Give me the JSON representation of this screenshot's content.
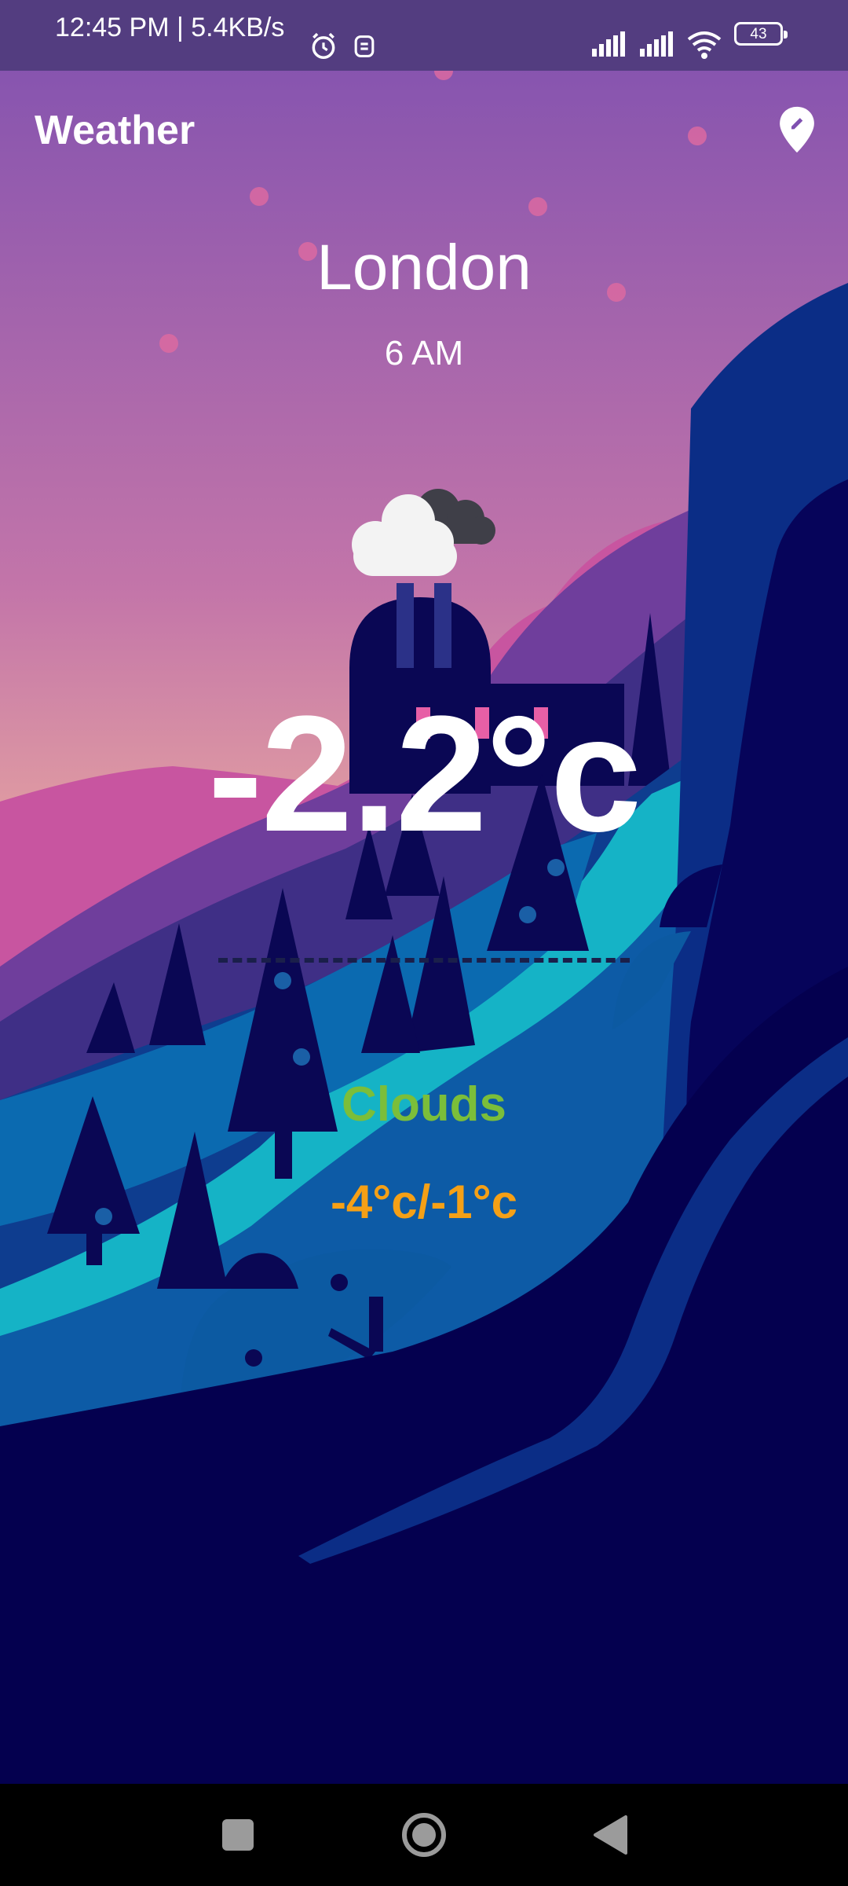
{
  "status_bar": {
    "time_speed": "12:45 PM | 5.4KB/s",
    "battery": "43",
    "icons": [
      "alarm-icon",
      "app-notification-icon",
      "signal-icon",
      "signal-icon",
      "wifi-icon",
      "battery-icon"
    ]
  },
  "app_bar": {
    "title": "Weather",
    "location_icon": "map-pin-edit-icon"
  },
  "weather": {
    "city": "London",
    "time": "6 AM",
    "icon": "cloud-icon",
    "temperature": "-2.2°c",
    "condition": "Clouds",
    "range": "-4°c/-1°c"
  },
  "nav_bar": {
    "buttons": [
      "recents-button",
      "home-button",
      "back-button"
    ]
  },
  "colors": {
    "sky_top": "#7f50b0",
    "sky_horizon": "#ffc59a",
    "ground": "#04004f",
    "condition": "#7bbe3a",
    "range": "#f5a016"
  }
}
